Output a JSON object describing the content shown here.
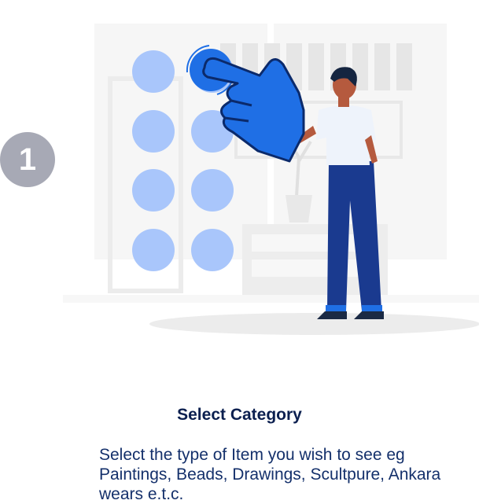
{
  "step": {
    "number": "1",
    "title": "Select Category",
    "description": "Select the type of Item you wish to see eg Paintings, Beads, Drawings, Scultpure, Ankara wears e.t.c."
  },
  "illustration": {
    "icon": "hand-pointer-icon",
    "accent_color": "#1f6fe5",
    "circle_color": "#a9c6fb",
    "figure_color": "#1a3a8f"
  }
}
